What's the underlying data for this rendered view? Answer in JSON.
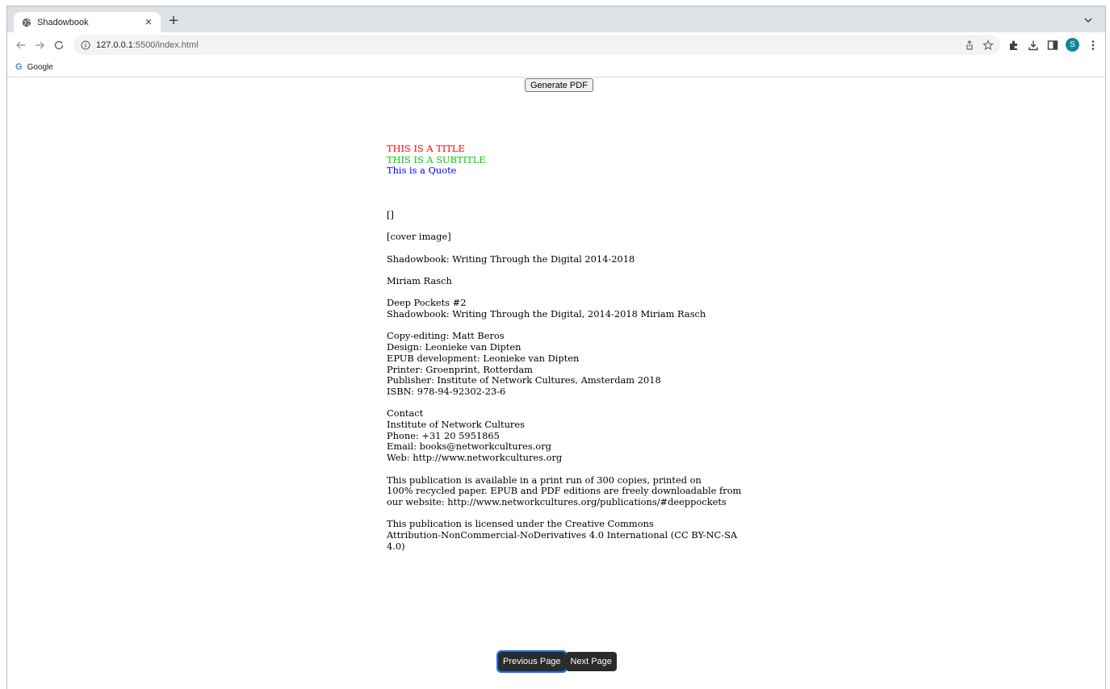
{
  "browser": {
    "tab": {
      "title": "Shadowbook",
      "close_glyph": "×",
      "favicon": "globe-icon"
    },
    "new_tab_glyph": "+",
    "tab_search_icon": "chevron-down-icon",
    "address": {
      "host": "127.0.0.1",
      "path": ":5500/index.html"
    },
    "profile_initial": "S",
    "profile_color": "#0b8a96",
    "bookmarks": [
      {
        "icon_glyph": "G",
        "label": "Google"
      }
    ]
  },
  "page": {
    "generate_pdf_label": "Generate PDF",
    "header": {
      "title": "THIS IS A TITLE",
      "title_color": "#ff0000",
      "subtitle": "THIS IS A SUBTITLE",
      "subtitle_color": "#00cc00",
      "quote": "This is a Quote",
      "quote_color": "#0000ff"
    },
    "brackets": "[]",
    "cover_image": "[cover image]",
    "book_title": "Shadowbook: Writing Through the Digital 2014-2018",
    "author": "Miriam Rasch",
    "series": [
      "Deep Pockets #2",
      "Shadowbook: Writing Through the Digital, 2014-2018 Miriam Rasch"
    ],
    "credits": [
      "Copy-editing: Matt Beros",
      "Design: Leonieke van Dipten",
      "EPUB development: Leonieke van Dipten",
      "Printer: Groenprint, Rotterdam",
      "Publisher: Institute of Network Cultures, Amsterdam 2018",
      "ISBN: 978-94-92302-23-6"
    ],
    "contact": [
      "Contact",
      "Institute of Network Cultures",
      "Phone: +31 20 5951865",
      "Email: books@networkcultures.org",
      "Web: http://www.networkcultures.org"
    ],
    "availability": [
      "This publication is available in a print run of 300 copies, printed on",
      "100% recycled paper. EPUB and PDF editions are freely downloadable from",
      "our website: http://www.networkcultures.org/publications/#deeppockets"
    ],
    "license": [
      "This publication is licensed under the Creative Commons",
      "Attribution-NonCommercial-NoDerivatives 4.0 International (CC BY-NC-SA",
      "4.0)"
    ],
    "prev_label": "Previous Page",
    "next_label": "Next Page"
  }
}
